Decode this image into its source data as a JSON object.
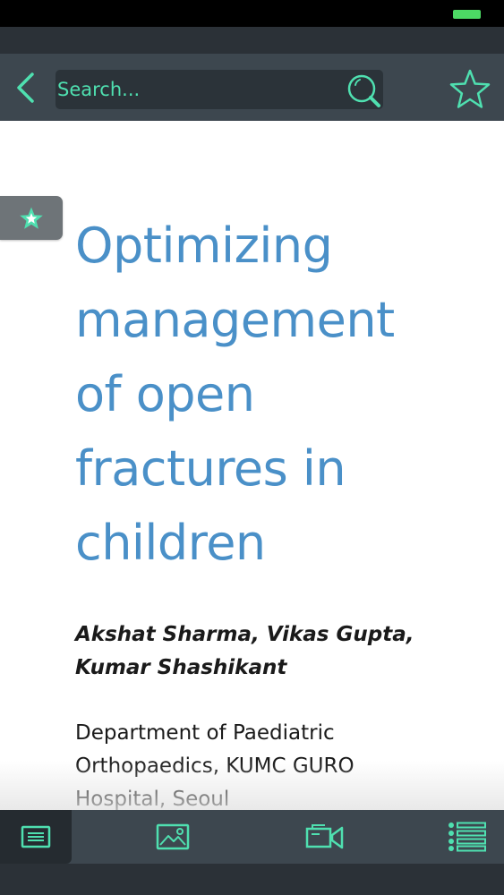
{
  "colors": {
    "accent": "#4fe0b0",
    "battery": "#4cd964",
    "title": "#4a90c8",
    "navbar": "#3d474f",
    "statusbar": "#000000"
  },
  "navbar": {
    "back_icon": "chevron-left-icon",
    "search": {
      "placeholder": "Search...",
      "value": ""
    },
    "search_icon": "search-icon",
    "favorite_icon": "star-icon"
  },
  "bookmark": {
    "icon": "star-icon"
  },
  "article": {
    "title_lines": [
      "Optimizing",
      "management",
      "of open",
      "fractures in",
      "children"
    ],
    "authors_lines": [
      "Akshat Sharma, Vikas Gupta,",
      "Kumar Shashikant"
    ],
    "affiliation_lines": [
      "Department of Paediatric",
      "Orthopaedics, KUMC GURO",
      "Hospital, Seoul"
    ]
  },
  "tabbar": {
    "items": [
      {
        "id": "text",
        "icon": "text-document-icon",
        "active": true
      },
      {
        "id": "images",
        "icon": "image-icon",
        "active": false
      },
      {
        "id": "media",
        "icon": "video-icon",
        "active": false
      },
      {
        "id": "contents",
        "icon": "list-icon",
        "active": false
      }
    ]
  }
}
